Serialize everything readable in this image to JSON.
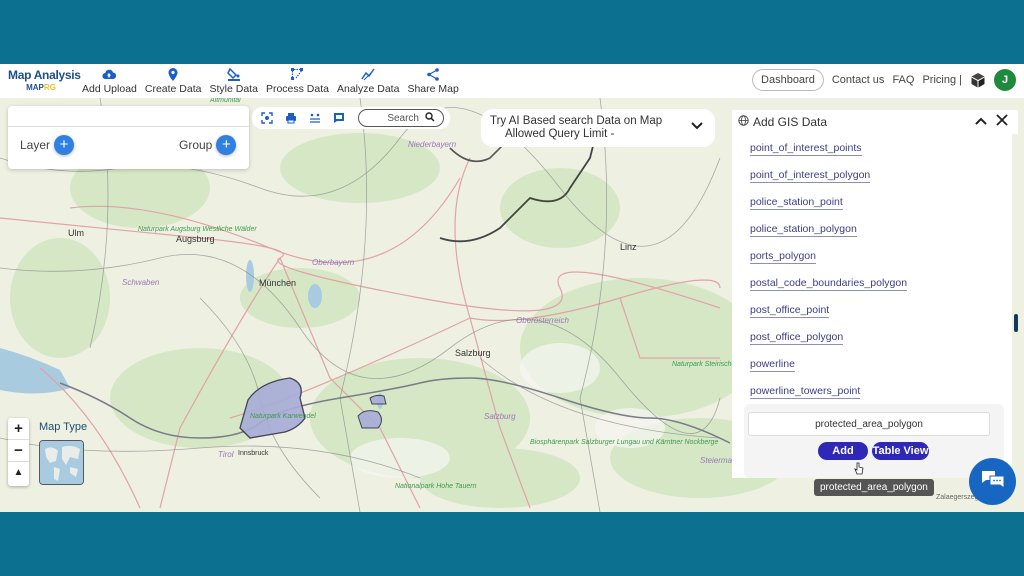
{
  "brand": {
    "title": "Map Analysis",
    "logo_prefix": "MAP",
    "logo_suffix": "RG"
  },
  "nav": [
    {
      "label": "Add Upload",
      "icon": "cloud-upload-icon"
    },
    {
      "label": "Create Data",
      "icon": "map-pin-icon"
    },
    {
      "label": "Style Data",
      "icon": "paint-bucket-icon"
    },
    {
      "label": "Process Data",
      "icon": "process-icon"
    },
    {
      "label": "Analyze Data",
      "icon": "analyze-icon"
    },
    {
      "label": "Share Map",
      "icon": "share-icon"
    }
  ],
  "right_nav": {
    "dashboard": "Dashboard",
    "contact": "Contact us",
    "faq": "FAQ",
    "pricing": "Pricing |",
    "avatar_initial": "J"
  },
  "layer_panel": {
    "layer_label": "Layer",
    "group_label": "Group"
  },
  "toolbar": {
    "search_placeholder": "Search"
  },
  "ai_search": {
    "line1": "Try AI Based search Data on Map",
    "line2": "Allowed Query Limit -"
  },
  "gis_panel": {
    "title": "Add GIS Data",
    "items": [
      "point_of_interest_points",
      "point_of_interest_polygon",
      "police_station_point",
      "police_station_polygon",
      "ports_polygon",
      "postal_code_boundaries_polygon",
      "post_office_point",
      "post_office_polygon",
      "powerline",
      "powerline_towers_point"
    ],
    "selected": "protected_area_polygon",
    "add_label": "Add",
    "table_view_label": "Table View",
    "tooltip": "protected_area_polygon"
  },
  "map": {
    "map_type_label": "Map Type",
    "labels": {
      "altmuhltal": "Altmühltal",
      "niederbayern": "Niederbayern",
      "ulm": "Ulm",
      "augsburg": "Augsburg",
      "naturpark_augsburg": "Naturpark Augsburg Westliche Wälder",
      "schwaben": "Schwaben",
      "munchen": "München",
      "oberbayern": "Oberbayern",
      "linz": "Linz",
      "oberosterreich": "Oberösterreich",
      "salzburg_city": "Salzburg",
      "salzburg_region": "Salzburg",
      "karwendel": "Naturpark Karwendel",
      "tirol": "Tirol",
      "innsbruck": "Innsbruck",
      "biosphere": "Biosphärenpark Salzburger Lungau und Kärntner Nockberge",
      "steirische": "Naturpark Steirische Eisenwurzen",
      "steiermark": "Steiermark",
      "hohe_tauern": "Nationalpark Hohe Tauern",
      "zalaegerszeg": "Zalaegerszeg"
    }
  }
}
